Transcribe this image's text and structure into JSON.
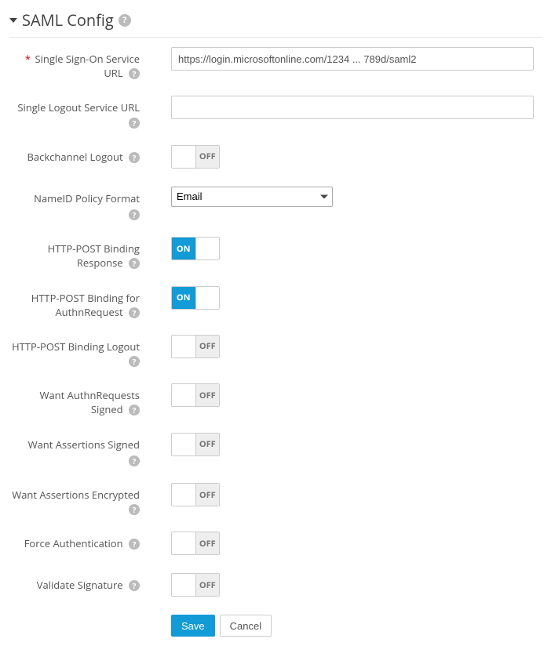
{
  "section_title": "SAML Config",
  "fields": {
    "sso_url": {
      "label": "Single Sign-On Service URL",
      "required": true,
      "value": "https://login.microsoftonline.com/1234 ... 789d/saml2"
    },
    "slo_url": {
      "label": "Single Logout Service URL",
      "value": ""
    },
    "backchannel_logout": {
      "label": "Backchannel Logout",
      "value": "off"
    },
    "nameid_policy": {
      "label": "NameID Policy Format",
      "selected": "Email"
    },
    "http_post_response": {
      "label": "HTTP-POST Binding Response",
      "value": "on"
    },
    "http_post_authn": {
      "label": "HTTP-POST Binding for AuthnRequest",
      "value": "on"
    },
    "http_post_logout": {
      "label": "HTTP-POST Binding Logout",
      "value": "off"
    },
    "want_authn_signed": {
      "label": "Want AuthnRequests Signed",
      "value": "off"
    },
    "want_assertions_signed": {
      "label": "Want Assertions Signed",
      "value": "off"
    },
    "want_assertions_encrypted": {
      "label": "Want Assertions Encrypted",
      "value": "off"
    },
    "force_auth": {
      "label": "Force Authentication",
      "value": "off"
    },
    "validate_signature": {
      "label": "Validate Signature",
      "value": "off"
    }
  },
  "toggle_text": {
    "on": "ON",
    "off": "OFF"
  },
  "buttons": {
    "save": "Save",
    "cancel": "Cancel"
  }
}
